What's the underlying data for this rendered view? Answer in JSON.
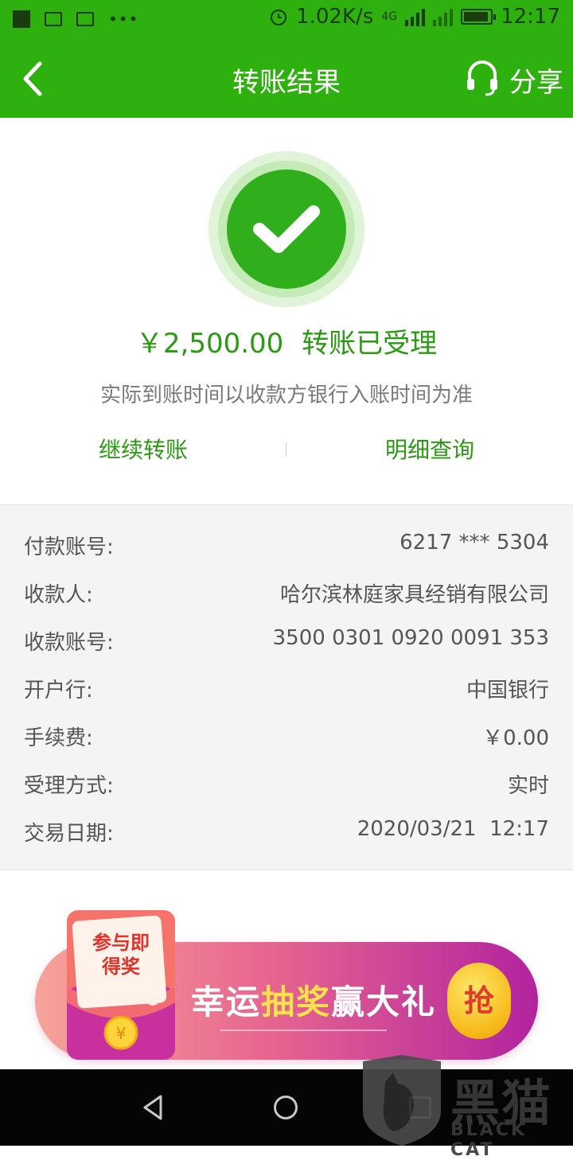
{
  "status_bar": {
    "net_speed": "1.02K/s",
    "net_type": "4G",
    "time": "12:17"
  },
  "header": {
    "title": "转账结果",
    "share_label": "分享"
  },
  "result": {
    "amount": "￥2,500.00",
    "status": "转账已受理",
    "note": "实际到账时间以收款方银行入账时间为准",
    "actions": [
      "继续转账",
      "明细查询"
    ]
  },
  "details": [
    {
      "label": "付款账号:",
      "value": "6217 *** 5304"
    },
    {
      "label": "收款人:",
      "value": "哈尔滨林庭家具经销有限公司"
    },
    {
      "label": "收款账号:",
      "value": "3500 0301 0920 0091 353"
    },
    {
      "label": "开户行:",
      "value": "中国银行"
    },
    {
      "label": "手续费:",
      "value": "￥0.00"
    },
    {
      "label": "受理方式:",
      "value": "实时"
    },
    {
      "label": "交易日期:",
      "value": "2020/03/21  12:17"
    }
  ],
  "promo": {
    "envelope_text_1": "参与即",
    "envelope_text_2": "得奖",
    "text_1": "幸运",
    "text_hl": "抽奖",
    "text_2": "赢大礼",
    "grab_label": "抢"
  },
  "watermark": {
    "cn": "黑猫",
    "en": "BLACK CAT"
  },
  "colors": {
    "brand_green": "#2eb00e",
    "text_green": "#2a9a12",
    "detail_bg": "#f4f4f4"
  },
  "icons": [
    "back-arrow-icon",
    "headset-icon",
    "check-icon",
    "nav-back-icon",
    "nav-home-icon",
    "nav-recent-icon"
  ]
}
